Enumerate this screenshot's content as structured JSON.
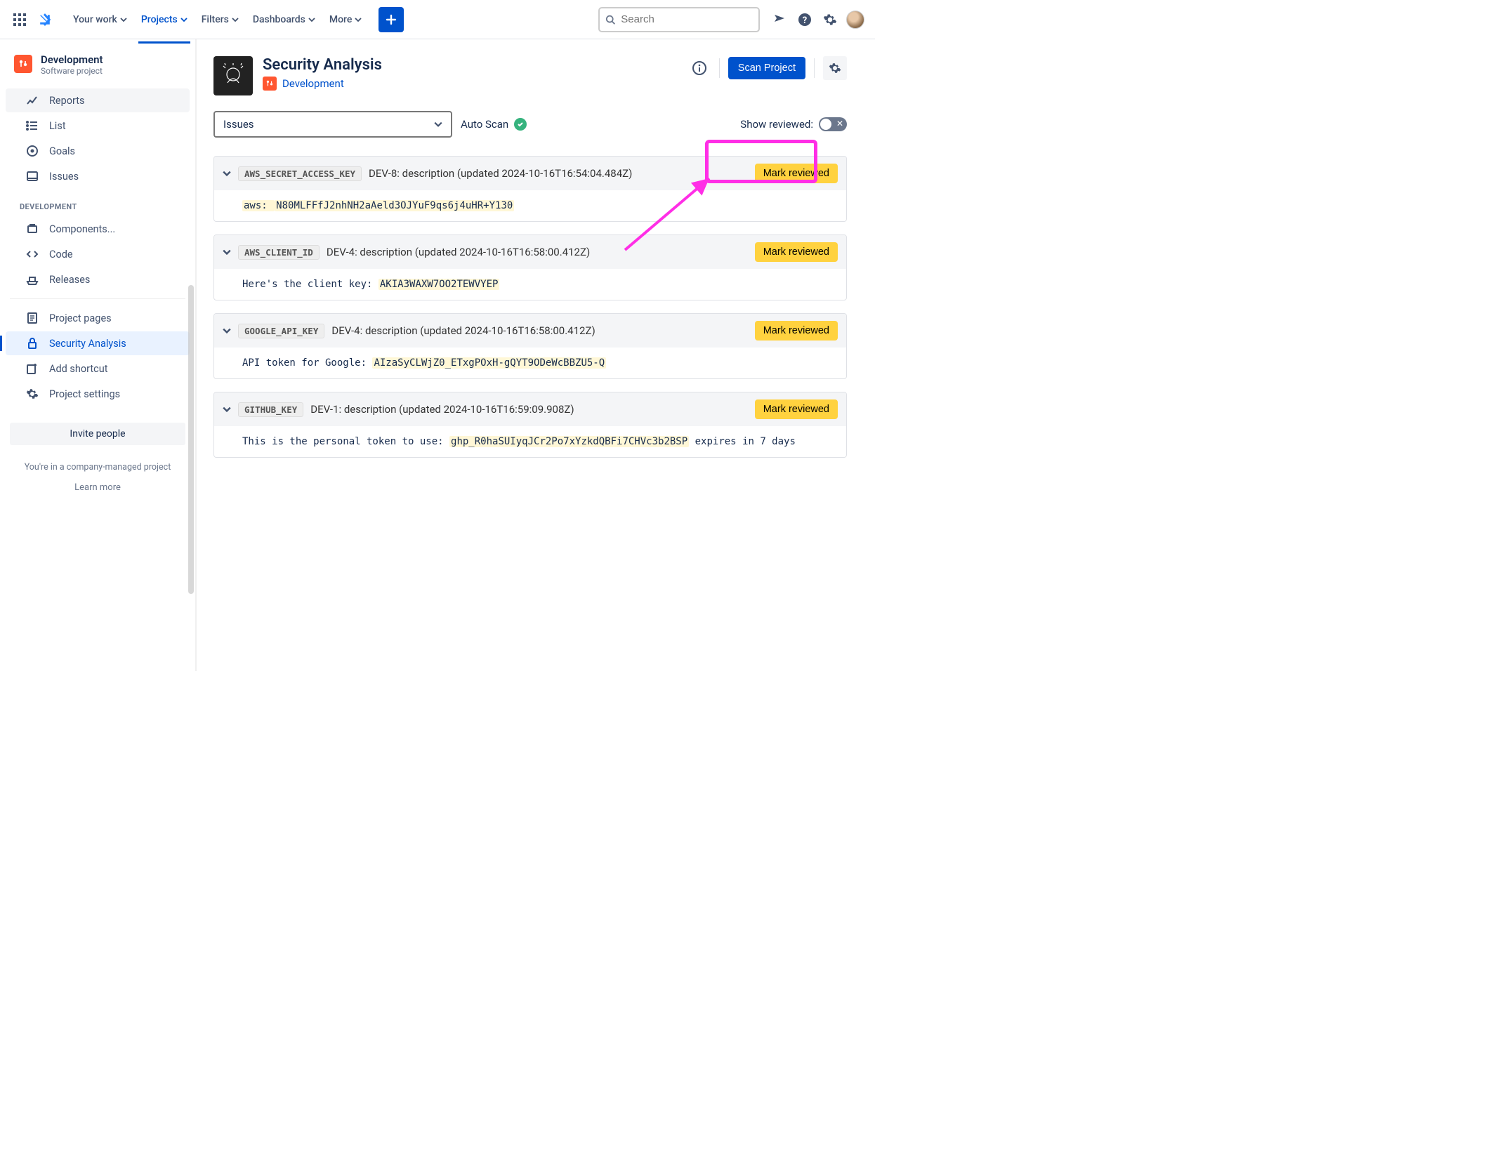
{
  "topnav": {
    "items": [
      {
        "label": "Your work"
      },
      {
        "label": "Projects"
      },
      {
        "label": "Filters"
      },
      {
        "label": "Dashboards"
      },
      {
        "label": "More"
      }
    ],
    "search_placeholder": "Search"
  },
  "sidebar": {
    "project_title": "Development",
    "project_sub": "Software project",
    "group1": [
      {
        "label": "Reports",
        "icon": "chart"
      },
      {
        "label": "List",
        "icon": "list"
      },
      {
        "label": "Goals",
        "icon": "target"
      },
      {
        "label": "Issues",
        "icon": "issues"
      }
    ],
    "section_label": "DEVELOPMENT",
    "group2": [
      {
        "label": "Components...",
        "icon": "component"
      },
      {
        "label": "Code",
        "icon": "code"
      },
      {
        "label": "Releases",
        "icon": "ship"
      }
    ],
    "group3": [
      {
        "label": "Project pages",
        "icon": "page"
      },
      {
        "label": "Security Analysis",
        "icon": "lock",
        "selected": true
      },
      {
        "label": "Add shortcut",
        "icon": "addshortcut"
      },
      {
        "label": "Project settings",
        "icon": "gear"
      }
    ],
    "invite": "Invite people",
    "footer": "You're in a company-managed project",
    "footer_link": "Learn more"
  },
  "page": {
    "title": "Security Analysis",
    "project_link": "Development",
    "scan_btn": "Scan Project",
    "select_label": "Issues",
    "autoscan_label": "Auto Scan",
    "toggle_label": "Show reviewed:",
    "mark_reviewed": "Mark reviewed"
  },
  "findings": [
    {
      "tag": "AWS_SECRET_ACCESS_KEY",
      "title": "DEV-8: description (updated 2024-10-16T16:54:04.484Z)",
      "body_pre": "aws: ",
      "body_hl": "N80MLFFfJ2nhNH2aAeld3OJYuF9qs6j4uHR+Y130",
      "body_post": ""
    },
    {
      "tag": "AWS_CLIENT_ID",
      "title": "DEV-4: description (updated 2024-10-16T16:58:00.412Z)",
      "body_pre": "Here's the client key: ",
      "body_hl": "AKIA3WAXW7OO2TEWVYEP",
      "body_post": ""
    },
    {
      "tag": "GOOGLE_API_KEY",
      "title": "DEV-4: description (updated 2024-10-16T16:58:00.412Z)",
      "body_pre": "API token for Google: ",
      "body_hl": "AIzaSyCLWjZ0_ETxgPOxH-gQYT9ODeWcBBZU5-Q",
      "body_post": ""
    },
    {
      "tag": "GITHUB_KEY",
      "title": "DEV-1: description (updated 2024-10-16T16:59:09.908Z)",
      "body_pre": "This is the personal token to use: ",
      "body_hl": "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",
      "body_post": " expires in 7 days"
    }
  ]
}
